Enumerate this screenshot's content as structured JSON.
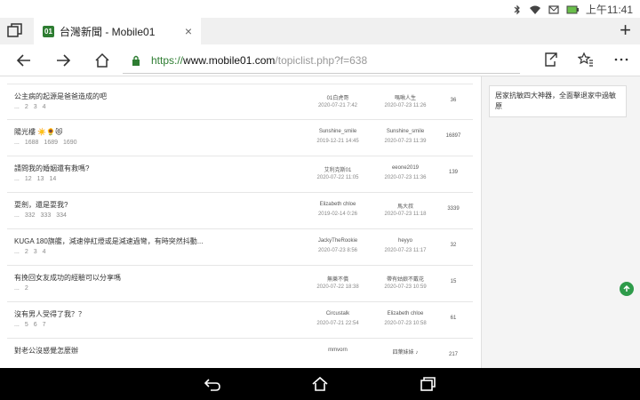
{
  "status": {
    "time": "上午11:41",
    "icons": [
      "bluetooth-icon",
      "wifi-icon",
      "email-icon",
      "battery-icon"
    ]
  },
  "tab": {
    "favicon": "01",
    "title": "台灣新聞 - Mobile01",
    "close": "×",
    "new_tab": "+"
  },
  "address": {
    "scheme": "https://",
    "host": "www.mobile01.com",
    "path": "/topiclist.php?f=638"
  },
  "topics": [
    {
      "title": "公主病的起源是爸爸造成的吧",
      "pages": [
        "...",
        "2",
        "3",
        "4"
      ],
      "author": "01白虎哥",
      "author_date": "2020-07-21 7:42",
      "last_user": "嗎啾人生",
      "last_date": "2020-07-23 11:26",
      "replies": "36"
    },
    {
      "title": "陽光樓 ☀️🌻😻",
      "pages": [
        "...",
        "1688",
        "1689",
        "1690"
      ],
      "author": "Sunshine_smile",
      "author_date": "2019-12-21 14:45",
      "last_user": "Sunshine_smile",
      "last_date": "2020-07-23 11:39",
      "replies": "16897"
    },
    {
      "title": "請問我的婚姻還有救嗎?",
      "pages": [
        "...",
        "12",
        "13",
        "14"
      ],
      "author": "艾利克斯01",
      "author_date": "2020-07-22 11:05",
      "last_user": "eeone2019",
      "last_date": "2020-07-23 11:36",
      "replies": "139"
    },
    {
      "title": "耍劍，還是耍我?",
      "pages": [
        "...",
        "332",
        "333",
        "334"
      ],
      "author": "Elizabeth chloe",
      "author_date": "2019-02-14 0:26",
      "last_user": "馬大叔",
      "last_date": "2020-07-23 11:18",
      "replies": "3339"
    },
    {
      "title": "KUGA 180旗艦，減速停紅燈或是減速過彎，有時突然抖動...",
      "pages": [
        "...",
        "2",
        "3",
        "4"
      ],
      "author": "JackyTheRookie",
      "author_date": "2020-07-23 8:56",
      "last_user": "heyyo",
      "last_date": "2020-07-23 11:17",
      "replies": "32"
    },
    {
      "title": "有挽回女友成功的經驗可以分享嗎",
      "pages": [
        "...",
        "2"
      ],
      "author": "無樂不償",
      "author_date": "2020-07-22 18:38",
      "last_user": "帶有姑娘不戴花",
      "last_date": "2020-07-23 10:59",
      "replies": "15"
    },
    {
      "title": "沒有男人受得了我？？",
      "pages": [
        "...",
        "5",
        "6",
        "7"
      ],
      "author": "Circustalk",
      "author_date": "2020-07-21 22:54",
      "last_user": "Elizabeth chloe",
      "last_date": "2020-07-23 10:58",
      "replies": "61"
    },
    {
      "title": "對老公沒感覺怎麼辦",
      "pages": [],
      "author": "mmvorn",
      "author_date": "",
      "last_user": "四葉妹妹 ♪",
      "last_date": "",
      "replies": "217"
    }
  ],
  "sidebar": {
    "card_text": "居家抗敏四大神器，全面擊退家中過敏原"
  },
  "colors": {
    "accent": "#2e7d32",
    "fab": "#2e9b4a"
  }
}
